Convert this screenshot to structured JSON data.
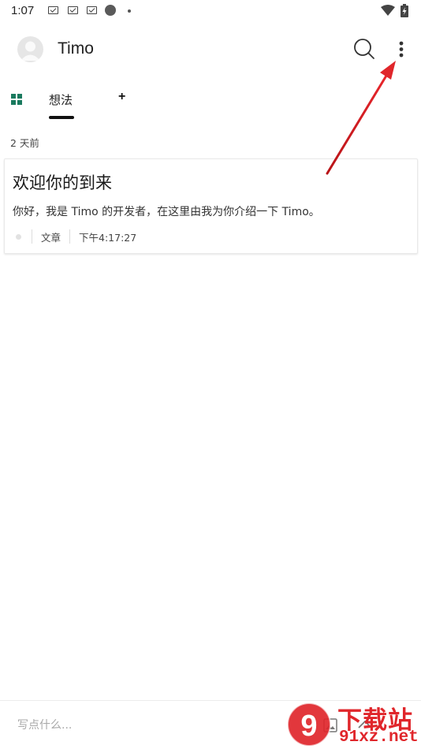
{
  "status_bar": {
    "time": "1:07",
    "icons": [
      "mail-icon",
      "mail-icon",
      "mail-icon",
      "circle-icon",
      "dot-icon",
      "wifi-icon",
      "battery-charging-icon"
    ]
  },
  "header": {
    "title": "Timo",
    "avatar_icon": "person-icon",
    "search_icon": "search-icon",
    "more_icon": "more-vertical-icon"
  },
  "tabs": {
    "grid_icon": "grid-icon",
    "items": [
      {
        "label": "想法",
        "active": true
      }
    ],
    "add_label": "+"
  },
  "feed": {
    "date_label": "2 天前",
    "cards": [
      {
        "title": "欢迎你的到来",
        "body": "你好，我是 Timo 的开发者，在这里由我为你介绍一下 Timo。",
        "category": "文章",
        "time": "下午4:17:27"
      }
    ]
  },
  "composer": {
    "placeholder": "写点什么...",
    "image_icon": "image-icon",
    "send_icon": "send-icon"
  },
  "watermark": {
    "logo_text": "9",
    "top_text": "下载站",
    "bottom_text": "91xz.net"
  },
  "colors": {
    "accent_green": "#1a7a5e",
    "annotation_red": "#e0262b",
    "text_primary": "#222222"
  }
}
